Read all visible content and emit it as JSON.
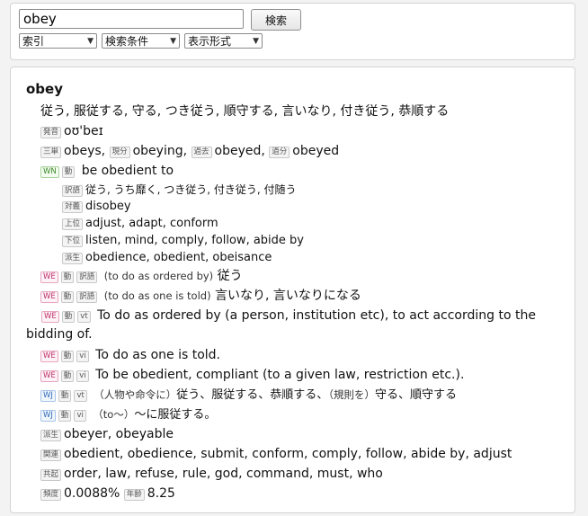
{
  "search": {
    "query": "obey",
    "button_label": "検索",
    "selects": [
      {
        "value": "索引"
      },
      {
        "value": "検索条件"
      },
      {
        "value": "表示形式"
      }
    ]
  },
  "entry": {
    "headword": "obey",
    "definition_ja": "従う, 服従する, 守る, つき従う, 順守する, 言いなり, 付き従う, 恭順する",
    "pronunciation": {
      "tag": "発音",
      "text": "oʊ'beɪ"
    },
    "inflections": [
      {
        "tag": "三単",
        "text": "obeys,"
      },
      {
        "tag": "現分",
        "text": "obeying,"
      },
      {
        "tag": "過去",
        "text": "obeyed,"
      },
      {
        "tag": "過分",
        "text": "obeyed"
      }
    ],
    "wordnet": {
      "source": "WN",
      "pos": "動",
      "gloss": "be obedient to",
      "rows": [
        {
          "tag": "訳語",
          "text": "従う, うち靡く, つき従う, 付き従う, 付随う"
        },
        {
          "tag": "対義",
          "text": "disobey"
        },
        {
          "tag": "上位",
          "text": "adjust, adapt, conform"
        },
        {
          "tag": "下位",
          "text": "listen, mind, comply, follow, abide by"
        },
        {
          "tag": "派生",
          "text": "obedience, obedient, obeisance"
        }
      ]
    },
    "senses": [
      {
        "source": "WE",
        "pos": "動",
        "sub": "訳語",
        "note": "(to do as ordered by)",
        "text": "従う"
      },
      {
        "source": "WE",
        "pos": "動",
        "sub": "訳語",
        "note": "(to do as one is told)",
        "text": "言いなり, 言いなりになる"
      },
      {
        "source": "WE",
        "pos": "動",
        "sub": "vt",
        "note": "",
        "text": "To do as ordered by (a person, institution etc), to act according to the bidding of."
      },
      {
        "source": "WE",
        "pos": "動",
        "sub": "vi",
        "note": "",
        "text": "To do as one is told."
      },
      {
        "source": "WE",
        "pos": "動",
        "sub": "vi",
        "note": "",
        "text": "To be obedient, compliant (to a given law, restriction etc.)."
      },
      {
        "source": "WJ",
        "pos": "動",
        "sub": "vt",
        "note1": "（人物や命令に）",
        "text1": "従う、服従する、恭順する、",
        "note2": "（規則を）",
        "text2": "守る、順守する"
      },
      {
        "source": "WJ",
        "pos": "動",
        "sub": "vi",
        "note": "（to〜）",
        "text": "〜に服従する。"
      }
    ],
    "derived": {
      "tag": "派生",
      "text": "obeyer, obeyable"
    },
    "related": {
      "tag": "関連",
      "text": "obedient, obedience, submit, conform, comply, follow, abide by, adjust"
    },
    "collocations": {
      "tag": "共起",
      "text": "order, law, refuse, rule, god, command, must, who"
    },
    "stats": {
      "freq_tag": "頻度",
      "freq": "0.0088%",
      "age_tag": "年齢",
      "age": "8.25"
    }
  }
}
